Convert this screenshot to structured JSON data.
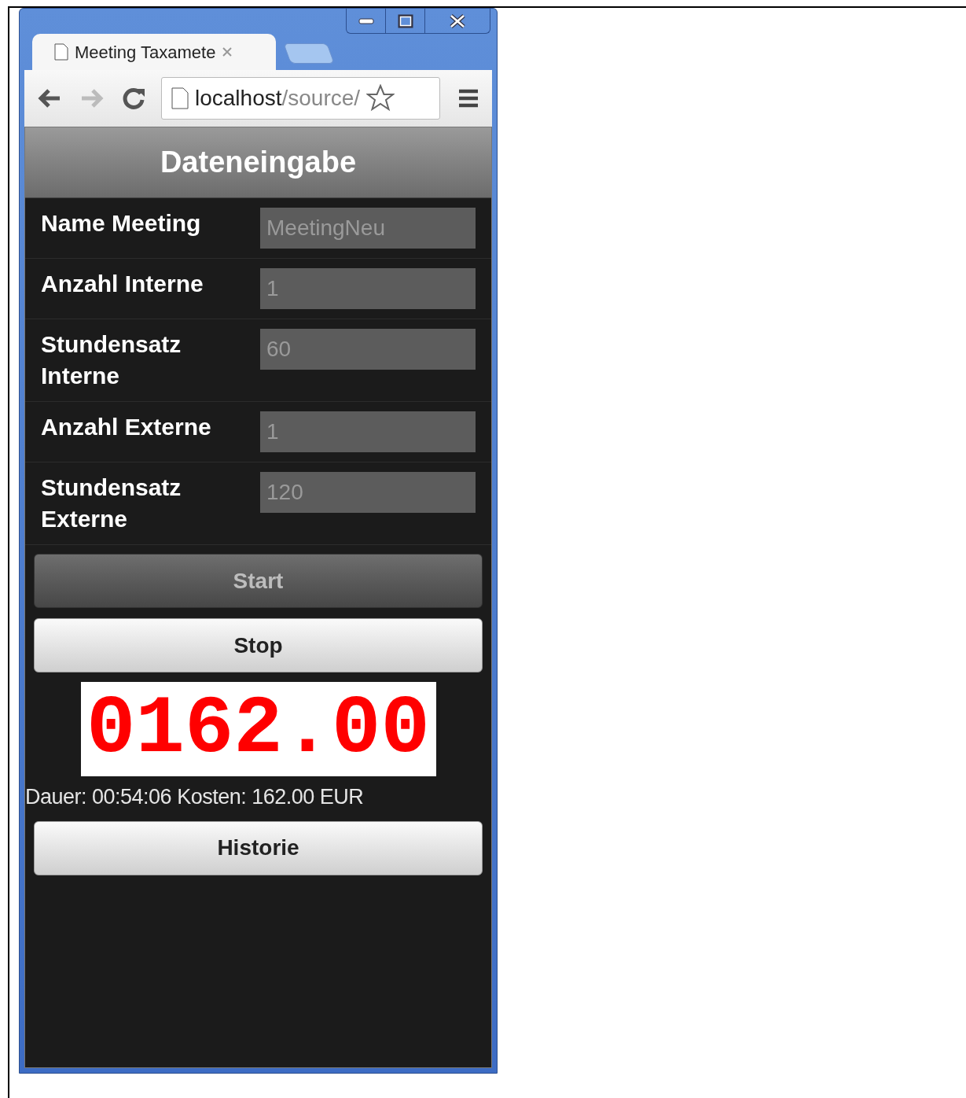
{
  "browser": {
    "tab_title": "Meeting Taxamete",
    "address_host": "localhost",
    "address_path": "/source/"
  },
  "header": {
    "title": "Dateneingabe"
  },
  "fields": [
    {
      "label": "Name Meeting",
      "value": "MeetingNeu",
      "disabled": true
    },
    {
      "label": "Anzahl Interne",
      "value": "1",
      "disabled": true
    },
    {
      "label": "Stundensatz Interne",
      "value": "60",
      "disabled": true
    },
    {
      "label": "Anzahl Externe",
      "value": "1",
      "disabled": true
    },
    {
      "label": "Stundensatz Externe",
      "value": "120",
      "disabled": true
    }
  ],
  "buttons": [
    {
      "label": "Start",
      "disabled": true
    },
    {
      "label": "Stop",
      "disabled": false
    }
  ],
  "display": {
    "digits": "0162.00"
  },
  "summary": "Dauer: 00:54:06 Kosten: 162.00 EUR",
  "history_button": {
    "label": "Historie",
    "disabled": false
  }
}
